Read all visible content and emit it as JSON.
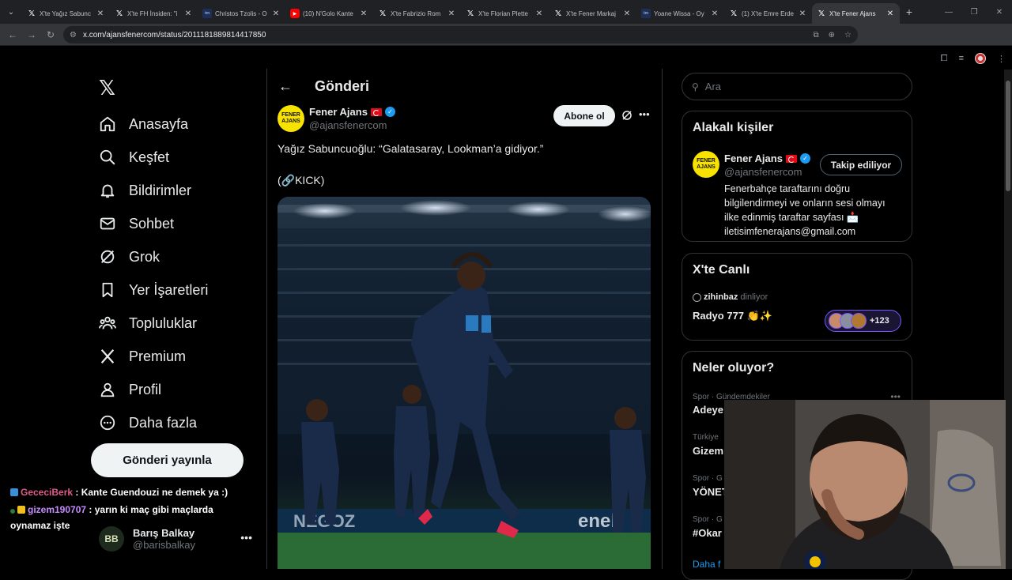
{
  "browser": {
    "tabs": [
      {
        "label": "X'te Yağız Sabunc",
        "favicon": "x"
      },
      {
        "label": "X'te FH İnsiden: \"i",
        "favicon": "x"
      },
      {
        "label": "Christos Tzolis - O",
        "favicon": "tw"
      },
      {
        "label": "(10) N'Golo Kante",
        "favicon": "yt"
      },
      {
        "label": "X'te Fabrizio Rom",
        "favicon": "x"
      },
      {
        "label": "X'te Florian Plette",
        "favicon": "x"
      },
      {
        "label": "X'te Fener Markaj",
        "favicon": "x"
      },
      {
        "label": "Yoane Wissa - Oy",
        "favicon": "tw"
      },
      {
        "label": "(1) X'te Emre Erde",
        "favicon": "x"
      },
      {
        "label": "X'te Fener Ajans",
        "favicon": "x",
        "active": true
      }
    ],
    "url": "x.com/ajansfenercom/status/2011181889814417850"
  },
  "nav": {
    "items": [
      {
        "label": "Anasayfa",
        "icon": "home-icon"
      },
      {
        "label": "Keşfet",
        "icon": "search-icon"
      },
      {
        "label": "Bildirimler",
        "icon": "bell-icon"
      },
      {
        "label": "Sohbet",
        "icon": "mail-icon"
      },
      {
        "label": "Grok",
        "icon": "grok-icon"
      },
      {
        "label": "Yer İşaretleri",
        "icon": "bookmark-icon"
      },
      {
        "label": "Topluluklar",
        "icon": "communities-icon"
      },
      {
        "label": "Premium",
        "icon": "x-premium-icon"
      },
      {
        "label": "Profil",
        "icon": "profile-icon"
      },
      {
        "label": "Daha fazla",
        "icon": "more-circle-icon"
      }
    ],
    "post_button": "Gönderi yayınla"
  },
  "stream_chat": [
    {
      "user": "GececiBerk",
      "sep": " : ",
      "message": "Kante Guendouzi ne demek ya :)"
    },
    {
      "user": "gizem190707",
      "sep": " : ",
      "message": "yarın ki maç gibi maçlarda",
      "message2": "oynamaz işte"
    }
  ],
  "account": {
    "name": "Barış Balkay",
    "handle": "@barisbalkay",
    "initials": "BB"
  },
  "post": {
    "header_title": "Gönderi",
    "author_name": "Fener Ajans",
    "author_handle": "@ajansfenercom",
    "avatar_text": "FENER AJANS",
    "subscribe_label": "Abone ol",
    "text": "Yağız Sabuncuoğlu: “Galatasaray, Lookman’a gidiyor.”",
    "text2": "(🔗KICK)"
  },
  "sidebar": {
    "search_placeholder": "Ara",
    "related": {
      "title": "Alakalı kişiler",
      "name": "Fener Ajans",
      "handle": "@ajansfenercom",
      "follow_label": "Takip ediliyor",
      "bio": "Fenerbahçe taraftarını doğru bilgilendirmeyi ve onların sesi olmayı ilke edinmiş taraftar sayfası 📩 iletisimfenerajans@gmail.com"
    },
    "live": {
      "title": "X'te Canlı",
      "user": "zihinbaz",
      "status": "dinliyor",
      "space_title": "Radyo 777 👏✨",
      "listeners": "+123"
    },
    "trends": {
      "title": "Neler oluyor?",
      "items": [
        {
          "category": "Spor · Gündemdekiler",
          "name": "Adeye"
        },
        {
          "category": "Türkiye",
          "name": "Gizem"
        },
        {
          "category": "Spor · G",
          "name": "YÖNET"
        },
        {
          "category": "Spor · G",
          "name": "#Okar"
        }
      ],
      "show_more": "Daha f"
    }
  },
  "colors": {
    "accent": "#1d9bf0",
    "background": "#000000",
    "border": "#2f3336",
    "chat_user1": "#e05a8c",
    "chat_user2": "#c78bff"
  }
}
